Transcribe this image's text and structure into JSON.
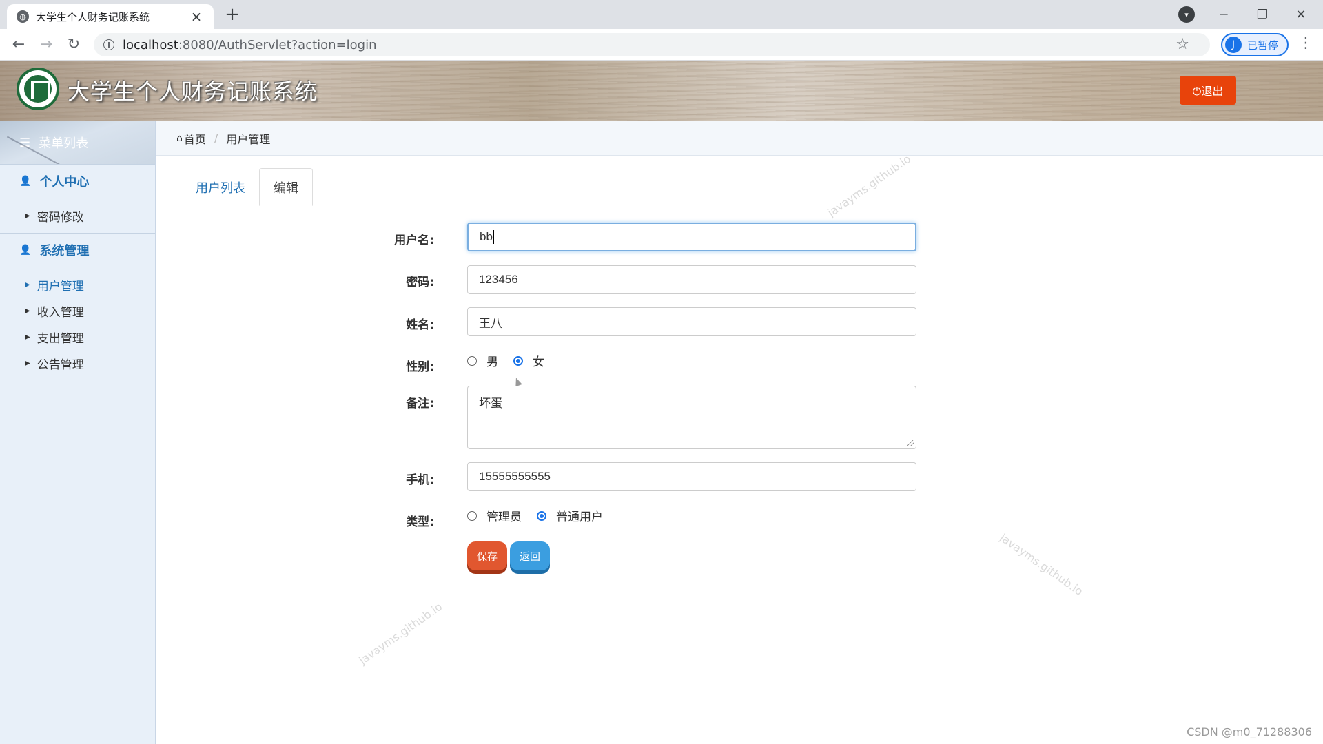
{
  "browser": {
    "tab_title": "大学生个人财务记账系统",
    "url_host": "localhost",
    "url_path": ":8080/AuthServlet?action=login",
    "profile_initial": "J",
    "profile_label": "已暂停"
  },
  "header": {
    "app_title": "大学生个人财务记账系统",
    "logout_label": "⏻退出"
  },
  "sidebar": {
    "menu_title": "菜单列表",
    "sections": [
      {
        "label": "个人中心",
        "items": [
          "密码修改"
        ]
      },
      {
        "label": "系统管理",
        "items": [
          "用户管理",
          "收入管理",
          "支出管理",
          "公告管理"
        ],
        "active": "用户管理"
      }
    ]
  },
  "breadcrumb": {
    "home": "首页",
    "current": "用户管理"
  },
  "tabs": {
    "list": "用户列表",
    "edit": "编辑",
    "active": "编辑"
  },
  "form": {
    "username_label": "用户名:",
    "username_value": "bb",
    "password_label": "密码:",
    "password_value": "123456",
    "name_label": "姓名:",
    "name_value": "王八",
    "gender_label": "性别:",
    "gender_options": [
      "男",
      "女"
    ],
    "gender_selected": "女",
    "remark_label": "备注:",
    "remark_value": "坏蛋",
    "phone_label": "手机:",
    "phone_value": "15555555555",
    "type_label": "类型:",
    "type_options": [
      "管理员",
      "普通用户"
    ],
    "type_selected": "普通用户",
    "save_label": "保存",
    "back_label": "返回"
  },
  "watermark_text": "javayms.github.io",
  "footer_credit": "CSDN @m0_71288306"
}
